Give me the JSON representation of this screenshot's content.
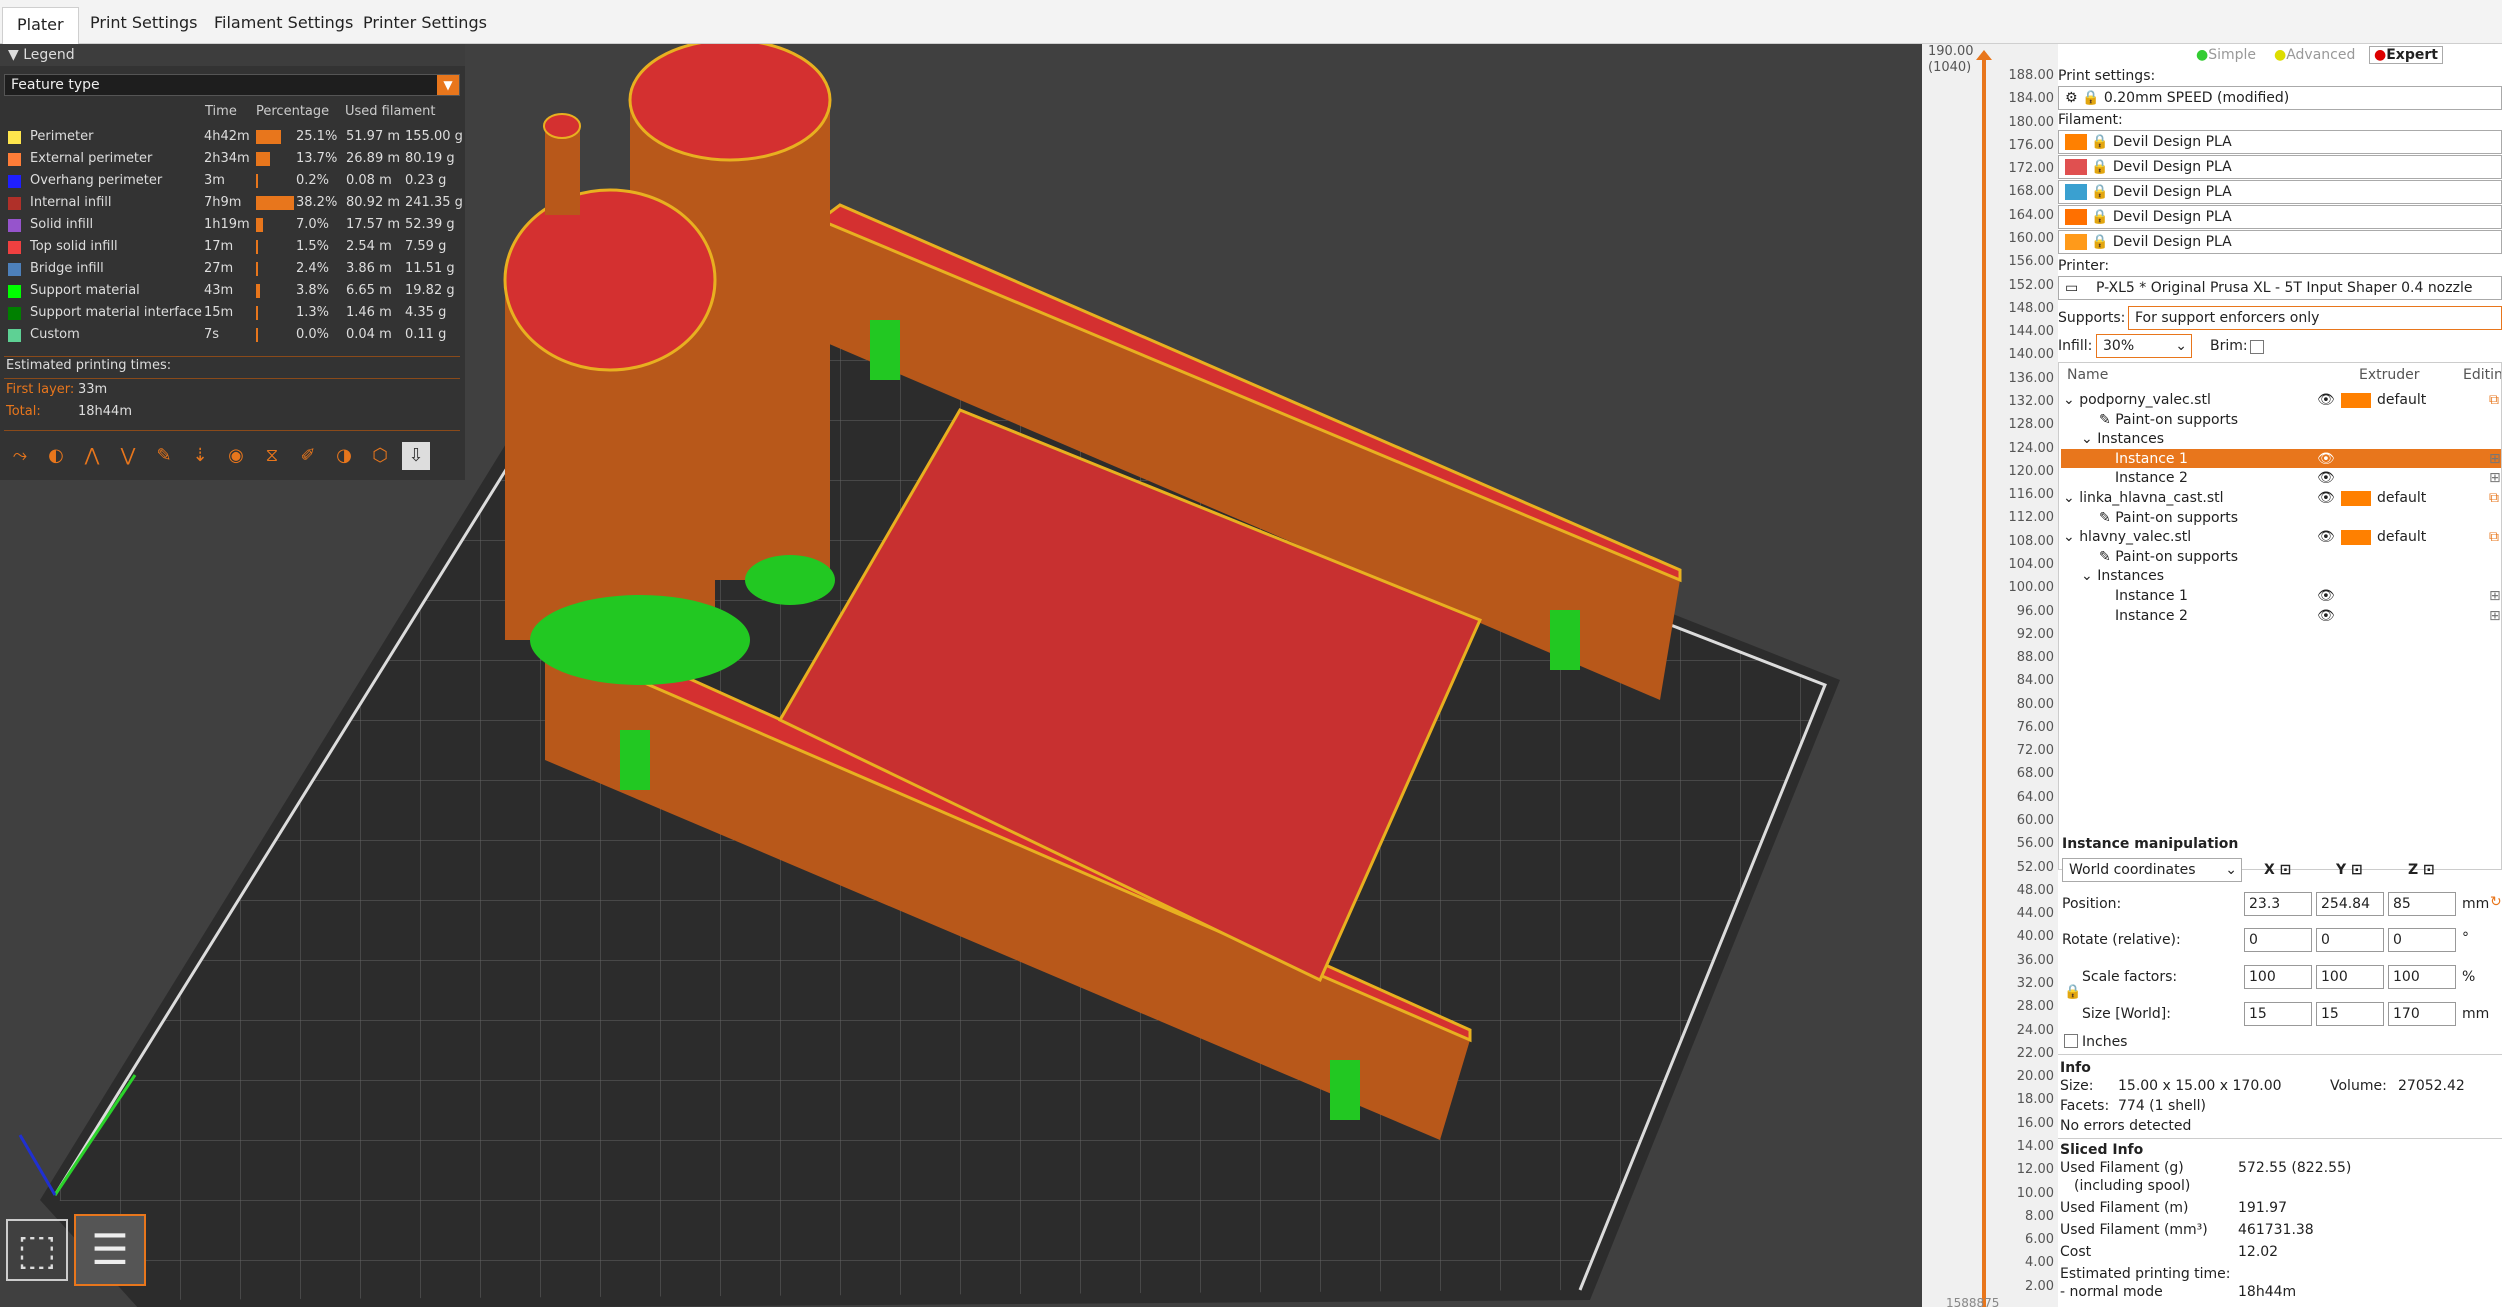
{
  "tabs": [
    "Plater",
    "Print Settings",
    "Filament Settings",
    "Printer Settings"
  ],
  "legend": {
    "title": "Legend",
    "feature_type": "Feature type",
    "headers": {
      "time": "Time",
      "percentage": "Percentage",
      "used": "Used filament"
    },
    "rows": [
      {
        "name": "Perimeter",
        "time": "4h42m",
        "pct": "25.1%",
        "len": "51.97 m",
        "weight": "155.00 g",
        "color": "#ffe64d",
        "frac": 0.251
      },
      {
        "name": "External perimeter",
        "time": "2h34m",
        "pct": "13.7%",
        "len": "26.89 m",
        "weight": "80.19 g",
        "color": "#ff7d38",
        "frac": 0.137
      },
      {
        "name": "Overhang perimeter",
        "time": "3m",
        "pct": "0.2%",
        "len": "0.08 m",
        "weight": "0.23 g",
        "color": "#1f1fff",
        "frac": 0.002
      },
      {
        "name": "Internal infill",
        "time": "7h9m",
        "pct": "38.2%",
        "len": "80.92 m",
        "weight": "241.35 g",
        "color": "#b03029",
        "frac": 0.382
      },
      {
        "name": "Solid infill",
        "time": "1h19m",
        "pct": "7.0%",
        "len": "17.57 m",
        "weight": "52.39 g",
        "color": "#9654cc",
        "frac": 0.07
      },
      {
        "name": "Top solid infill",
        "time": "17m",
        "pct": "1.5%",
        "len": "2.54 m",
        "weight": "7.59 g",
        "color": "#f04040",
        "frac": 0.015
      },
      {
        "name": "Bridge infill",
        "time": "27m",
        "pct": "2.4%",
        "len": "3.86 m",
        "weight": "11.51 g",
        "color": "#4d80ba",
        "frac": 0.024
      },
      {
        "name": "Support material",
        "time": "43m",
        "pct": "3.8%",
        "len": "6.65 m",
        "weight": "19.82 g",
        "color": "#00ff00",
        "frac": 0.038
      },
      {
        "name": "Support material interface",
        "time": "15m",
        "pct": "1.3%",
        "len": "1.46 m",
        "weight": "4.35 g",
        "color": "#008000",
        "frac": 0.013
      },
      {
        "name": "Custom",
        "time": "7s",
        "pct": "0.0%",
        "len": "0.04 m",
        "weight": "0.11 g",
        "color": "#5ed194",
        "frac": 0.0
      }
    ],
    "estimated": "Estimated printing times:",
    "first_layer_label": "First layer:",
    "first_layer": "33m",
    "total_label": "Total:",
    "total": "18h44m"
  },
  "ruler": {
    "top_value": "190.00",
    "top_layer": "(1040)",
    "bottom_label": "1588875",
    "ticks": [
      "188.00",
      "184.00",
      "180.00",
      "176.00",
      "172.00",
      "168.00",
      "164.00",
      "160.00",
      "156.00",
      "152.00",
      "148.00",
      "144.00",
      "140.00",
      "136.00",
      "132.00",
      "128.00",
      "124.00",
      "120.00",
      "116.00",
      "112.00",
      "108.00",
      "104.00",
      "100.00",
      "96.00",
      "92.00",
      "88.00",
      "84.00",
      "80.00",
      "76.00",
      "72.00",
      "68.00",
      "64.00",
      "60.00",
      "56.00",
      "52.00",
      "48.00",
      "44.00",
      "40.00",
      "36.00",
      "32.00",
      "28.00",
      "24.00",
      "22.00",
      "20.00",
      "18.00",
      "16.00",
      "14.00",
      "12.00",
      "10.00",
      "8.00",
      "6.00",
      "4.00",
      "2.00"
    ]
  },
  "modes": {
    "simple": "Simple",
    "advanced": "Advanced",
    "expert": "Expert"
  },
  "print_settings_label": "Print settings:",
  "print_profile": "0.20mm SPEED (modified)",
  "filament_label": "Filament:",
  "filaments": [
    {
      "name": "Devil Design PLA",
      "color": "#ff8000"
    },
    {
      "name": "Devil Design PLA",
      "color": "#e05050"
    },
    {
      "name": "Devil Design PLA",
      "color": "#3aa0d0"
    },
    {
      "name": "Devil Design PLA",
      "color": "#ff7000"
    },
    {
      "name": "Devil Design PLA",
      "color": "#ff9a1a"
    }
  ],
  "printer_label": "Printer:",
  "printer": "P-XL5 * Original Prusa XL - 5T Input Shaper 0.4 nozzle",
  "supports_label": "Supports:",
  "supports": "For support enforcers only",
  "infill_label": "Infill:",
  "infill": "30%",
  "brim_label": "Brim:",
  "objects_header": {
    "name": "Name",
    "extruder": "Extruder",
    "editing": "Editin"
  },
  "objects": [
    {
      "label": "podporny_valec.stl",
      "level": 0,
      "extruder": "default"
    },
    {
      "label": "Paint-on supports",
      "level": 2
    },
    {
      "label": "Instances",
      "level": 1
    },
    {
      "label": "Instance 1",
      "level": 2,
      "selected": true
    },
    {
      "label": "Instance 2",
      "level": 2
    },
    {
      "label": "linka_hlavna_cast.stl",
      "level": 0,
      "extruder": "default"
    },
    {
      "label": "Paint-on supports",
      "level": 2
    },
    {
      "label": "hlavny_valec.stl",
      "level": 0,
      "extruder": "default"
    },
    {
      "label": "Paint-on supports",
      "level": 2
    },
    {
      "label": "Instances",
      "level": 1
    },
    {
      "label": "Instance 1",
      "level": 2
    },
    {
      "label": "Instance 2",
      "level": 2
    }
  ],
  "manip": {
    "title": "Instance manipulation",
    "coords": "World coordinates",
    "x": "X",
    "y": "Y",
    "z": "Z",
    "position_label": "Position:",
    "position": [
      "23.3",
      "254.84",
      "85"
    ],
    "mm": "mm",
    "rotate_label": "Rotate (relative):",
    "rotate": [
      "0",
      "0",
      "0"
    ],
    "deg": "°",
    "scale_label": "Scale factors:",
    "scale": [
      "100",
      "100",
      "100"
    ],
    "pct": "%",
    "size_label": "Size [World]:",
    "size": [
      "15",
      "15",
      "170"
    ],
    "inches": "Inches"
  },
  "info": {
    "title": "Info",
    "size_label": "Size:",
    "size": "15.00 x 15.00 x 170.00",
    "volume_label": "Volume:",
    "volume": "27052.42",
    "facets_label": "Facets:",
    "facets": "774 (1 shell)",
    "errors": "No errors detected"
  },
  "sliced": {
    "title": "Sliced Info",
    "filament_g_label": "Used Filament (g)",
    "filament_g_sub": "(including spool)",
    "filament_g": "572.55 (822.55)",
    "filament_m_label": "Used Filament (m)",
    "filament_m": "191.97",
    "filament_mm3_label": "Used Filament (mm³)",
    "filament_mm3": "461731.38",
    "cost_label": "Cost",
    "cost": "12.02",
    "est_label": "Estimated printing time:",
    "normal_label": "- normal mode",
    "normal": "18h44m"
  }
}
